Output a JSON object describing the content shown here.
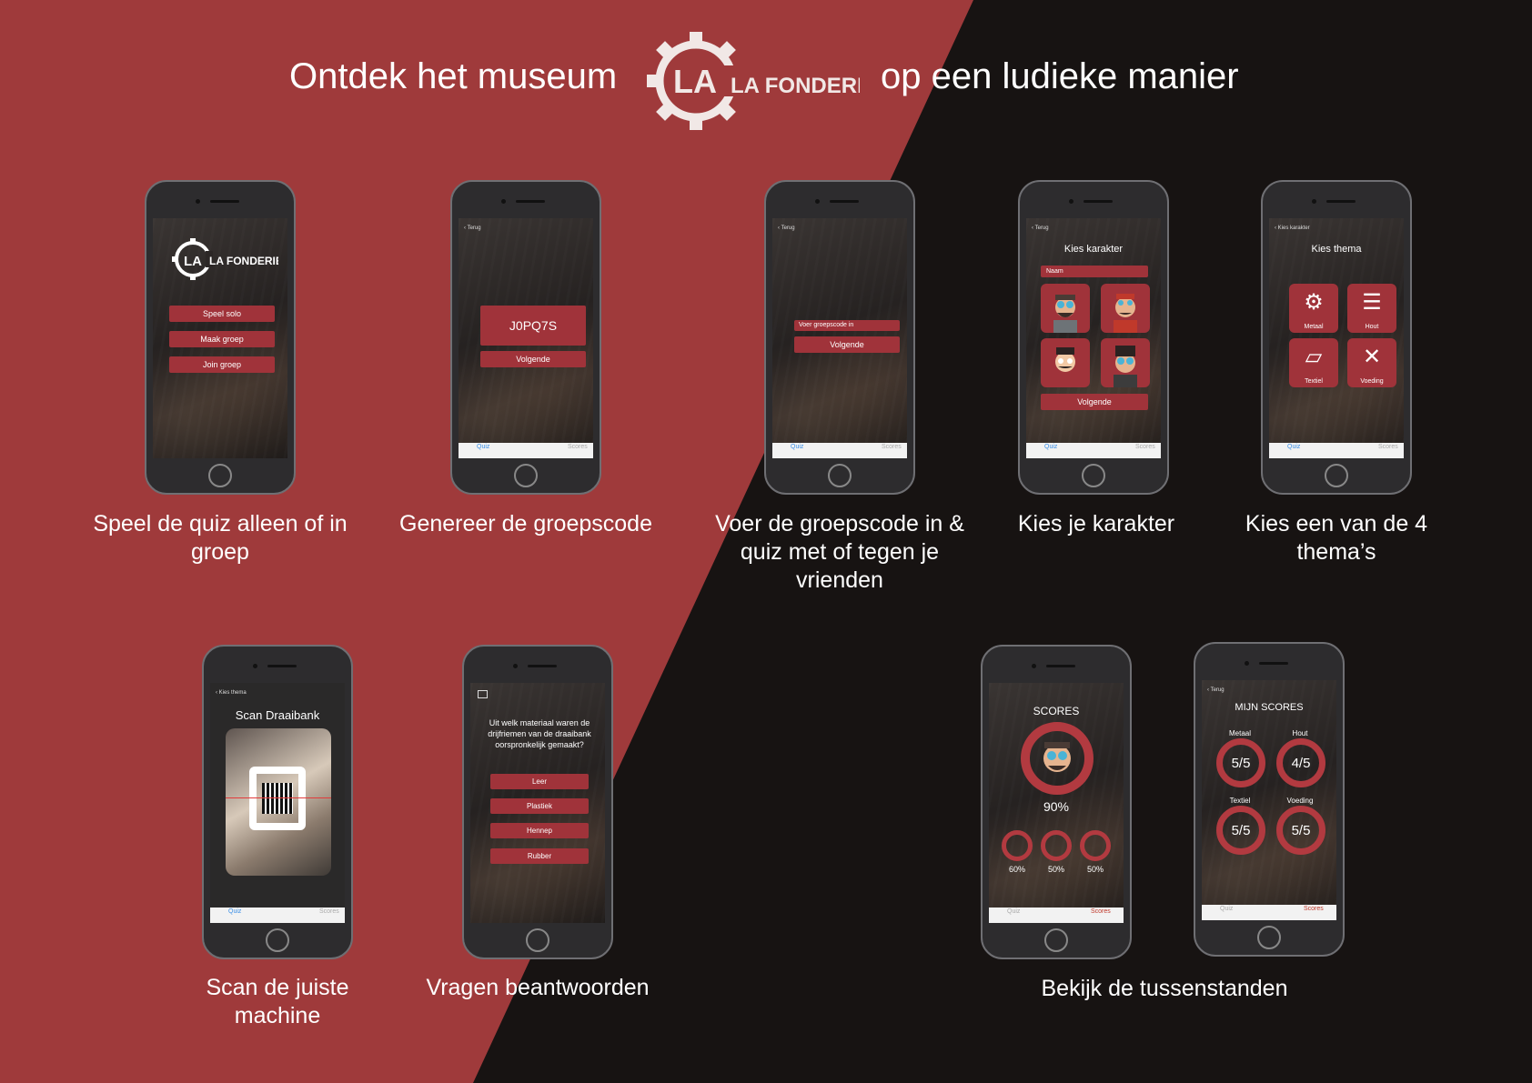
{
  "header": {
    "title_left": "Ontdek het museum",
    "title_right": "op een ludieke manier",
    "logo_text": "LA FONDERIE"
  },
  "colors": {
    "red": "#9f3a3b",
    "dark": "#171312",
    "button": "#a0333a",
    "tab_active": "#3a8ee6"
  },
  "screens": {
    "s1": {
      "logo_text": "LA FONDERIE",
      "buttons": [
        "Speel solo",
        "Maak groep",
        "Join groep"
      ],
      "caption": "Speel de quiz alleen of in groep"
    },
    "s2": {
      "back": "Terug",
      "code": "J0PQ7S",
      "next": "Volgende",
      "caption": "Genereer de groepscode",
      "tabs": [
        "Quiz",
        "Scores"
      ]
    },
    "s3": {
      "back": "Terug",
      "placeholder": "Voer groepscode in",
      "next": "Volgende",
      "caption": "Voer de groepscode in & quiz met of tegen je vrienden",
      "tabs": [
        "Quiz",
        "Scores"
      ]
    },
    "s4": {
      "back": "Terug",
      "title": "Kies karakter",
      "name_placeholder": "Naam",
      "next": "Volgende",
      "caption": "Kies je karakter",
      "tabs": [
        "Quiz",
        "Scores"
      ]
    },
    "s5": {
      "back": "Kies karakter",
      "title": "Kies thema",
      "themes": [
        "Metaal",
        "Hout",
        "Textiel",
        "Voeding"
      ],
      "caption": "Kies een van de 4 thema’s",
      "tabs": [
        "Quiz",
        "Scores"
      ]
    },
    "s6": {
      "back": "Kies thema",
      "title": "Scan Draaibank",
      "caption": "Scan de juiste machine",
      "tabs": [
        "Quiz",
        "Scores"
      ]
    },
    "s7": {
      "question": "Uit welk materiaal waren de drijfriemen van de draaibank oorspronkelijk gemaakt?",
      "answers": [
        "Leer",
        "Plastiek",
        "Hennep",
        "Rubber"
      ],
      "caption": "Vragen beantwoorden"
    },
    "s8": {
      "title": "SCORES",
      "main_pct": "90%",
      "others": [
        "60%",
        "50%",
        "50%"
      ],
      "tabs": [
        "Quiz",
        "Scores"
      ]
    },
    "s9": {
      "back": "Terug",
      "title": "MIJN SCORES",
      "themes": [
        {
          "name": "Metaal",
          "score": "5/5"
        },
        {
          "name": "Hout",
          "score": "4/5"
        },
        {
          "name": "Textiel",
          "score": "5/5"
        },
        {
          "name": "Voeding",
          "score": "5/5"
        }
      ],
      "tabs": [
        "Quiz",
        "Scores"
      ]
    },
    "scores_caption": "Bekijk de tussenstanden"
  }
}
